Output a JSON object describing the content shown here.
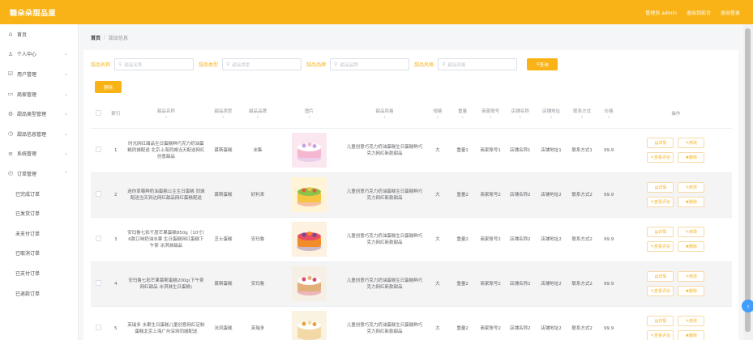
{
  "header": {
    "title": "糖朵朵甜品屋",
    "user_label": "管理员 admin",
    "front_link": "退出到前台",
    "logout_link": "退出登录"
  },
  "sidebar": {
    "items": [
      {
        "label": "首页",
        "icon": "home-icon",
        "expandable": false
      },
      {
        "label": "个人中心",
        "icon": "user-icon",
        "expandable": true
      },
      {
        "label": "用户管理",
        "icon": "users-icon",
        "expandable": true
      },
      {
        "label": "商家管理",
        "icon": "shop-icon",
        "expandable": true
      },
      {
        "label": "甜品类型管理",
        "icon": "gear-icon",
        "expandable": true
      },
      {
        "label": "甜品信息管理",
        "icon": "clock-icon",
        "expandable": true
      },
      {
        "label": "系统管理",
        "icon": "system-icon",
        "expandable": true
      },
      {
        "label": "订单管理",
        "icon": "order-icon",
        "expandable": true
      }
    ],
    "order_subitems": [
      "已完成订单",
      "已发货订单",
      "未支付订单",
      "已取消订单",
      "已支付订单",
      "已退款订单"
    ]
  },
  "breadcrumb": {
    "home": "首页",
    "current": "甜品信息"
  },
  "search": {
    "fields": [
      {
        "label": "甜品名称",
        "placeholder": "甜品名称"
      },
      {
        "label": "甜品类型",
        "placeholder": "甜品类型"
      },
      {
        "label": "甜品品牌",
        "placeholder": "甜品品牌"
      },
      {
        "label": "甜品风格",
        "placeholder": "甜品风格"
      }
    ],
    "button_label": "查询"
  },
  "toolbar": {
    "delete_label": "删除"
  },
  "table": {
    "columns": [
      "",
      "索引",
      "甜品名称",
      "甜品类型",
      "甜品品牌",
      "图片",
      "甜品风格",
      "规格",
      "重量",
      "商家账号",
      "店铺名称",
      "店铺地址",
      "联系方式",
      "价格",
      "操作"
    ],
    "sortable": [
      false,
      false,
      true,
      true,
      true,
      true,
      true,
      true,
      true,
      true,
      true,
      true,
      true,
      true,
      false
    ],
    "rows": [
      {
        "index": "1",
        "name": "时光网红甜品生日蛋糕鲜巧克力奶油蛋糕同城配送 北京上海同城当天配送网红创意甜品",
        "type": "慕斯蛋糕",
        "brand": "米集",
        "image": "pink-unicorn-cake",
        "style": "儿童创意巧克力奶油蛋糕生日蛋糕鲜巧克力网红新款甜品",
        "spec": "大",
        "weight": "重量1",
        "merchant": "商家账号1",
        "shop": "店铺名称1",
        "address": "店铺地址1",
        "contact": "联系方式1",
        "price": "99.9"
      },
      {
        "index": "2",
        "name": "迷你草莓鲜奶油蛋糕公主生日蛋糕 同城配送当天到达网红甜品网红蛋糕配送",
        "type": "慕斯蛋糕",
        "brand": "好利来",
        "image": "fruit-cake",
        "style": "儿童创意巧克力奶油蛋糕生日蛋糕鲜巧克力网红新款甜品",
        "spec": "大",
        "weight": "重量2",
        "merchant": "商家账号2",
        "shop": "店铺名称2",
        "address": "店铺地址2",
        "contact": "联系方式2",
        "price": "99.9"
      },
      {
        "index": "3",
        "name": "安玛鲁七彩千层芒果蛋糕850g（10寸）6款口味奶油水果 生日蛋糕网红蛋糕下午茶 冰淇淋甜品",
        "type": "芝士蛋糕",
        "brand": "安玛鲁",
        "image": "layer-cake",
        "style": "儿童创意巧克力奶油蛋糕生日蛋糕鲜巧克力网红新款甜品",
        "spec": "大",
        "weight": "重量2",
        "merchant": "商家账号2",
        "shop": "店铺名称2",
        "address": "店铺地址2",
        "contact": "联系方式2",
        "price": "99.9"
      },
      {
        "index": "4",
        "name": "安玛鲁七彩芒果慕斯蛋糕200g(下午茶网红甜品 冰淇淋生日蛋糕)",
        "type": "慕斯蛋糕",
        "brand": "安玛鲁",
        "image": "mousse-cake",
        "style": "儿童创意巧克力奶油蛋糕生日蛋糕鲜巧克力网红新款甜品",
        "spec": "大",
        "weight": "重量2",
        "merchant": "商家账号2",
        "shop": "店铺名称2",
        "address": "店铺地址2",
        "contact": "联系方式2",
        "price": "99.9"
      },
      {
        "index": "5",
        "name": "芙瑞多 水果生日蛋糕儿童创意网红定制蛋糕北京上海广州深圳同城配送",
        "type": "法风蛋糕",
        "brand": "芙瑞多",
        "image": "cream-cake",
        "style": "儿童创意巧克力奶油蛋糕生日蛋糕鲜巧克力网红新款甜品",
        "spec": "大",
        "weight": "重量2",
        "merchant": "商家账号2",
        "shop": "店铺名称2",
        "address": "店铺地址2",
        "contact": "联系方式2",
        "price": "99.9"
      }
    ],
    "actions": {
      "detail": "详情",
      "edit": "修改",
      "review": "查看评论",
      "delete": "删除"
    }
  },
  "colors": {
    "accent": "#f9b317",
    "header_bg": "#f9b317",
    "page_bg": "#f5f6f7"
  }
}
